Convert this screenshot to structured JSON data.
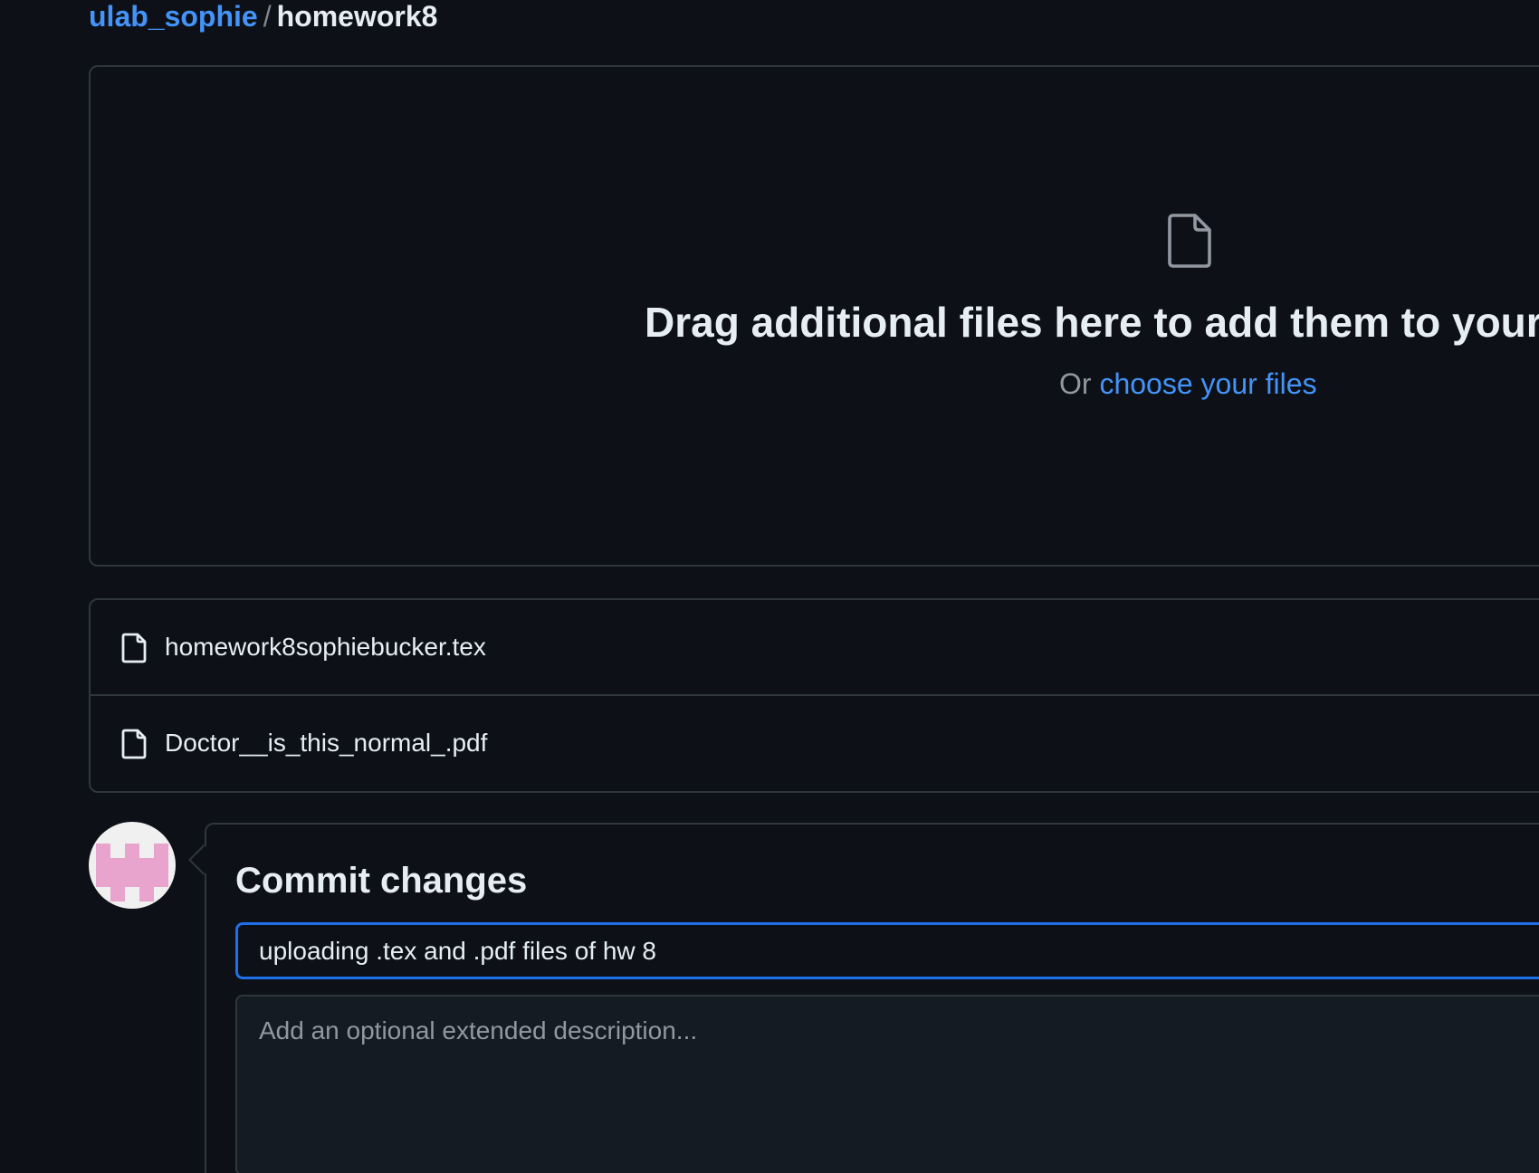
{
  "breadcrumb": {
    "owner": "ulab_sophie",
    "separator": "/",
    "repo": "homework8"
  },
  "dropzone": {
    "icon": "file-icon",
    "title": "Drag additional files here to add them to your r",
    "or_text": "Or",
    "choose_link": "choose your files"
  },
  "files": [
    {
      "name": "homework8sophiebucker.tex",
      "icon": "file-icon"
    },
    {
      "name": "Doctor__is_this_normal_.pdf",
      "icon": "file-icon"
    }
  ],
  "commit": {
    "title": "Commit changes",
    "summary_value": "uploading .tex and .pdf files of hw 8",
    "description_placeholder": "Add an optional extended description..."
  },
  "colors": {
    "background": "#0d1117",
    "link": "#4493f8",
    "border": "#30363d",
    "focus": "#1f6feb",
    "avatar_pink": "#e8a4cc"
  }
}
